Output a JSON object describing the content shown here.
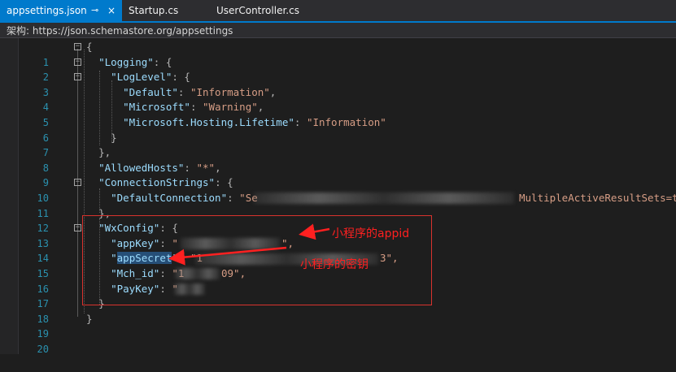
{
  "tabs": [
    {
      "label": "appsettings.json",
      "pin": "⊸",
      "close": "×"
    },
    {
      "label": "Startup.cs"
    },
    {
      "label": "UserController.cs"
    }
  ],
  "schema": {
    "text": "架构: https://json.schemastore.org/appsettings"
  },
  "editor": {
    "line_numbers": [
      "1",
      "2",
      "3",
      "4",
      "5",
      "6",
      "7",
      "8",
      "9",
      "10",
      "11",
      "12",
      "13",
      "14",
      "15",
      "16",
      "17",
      "18",
      "19",
      "20"
    ],
    "l1": "{",
    "l2_key": "\"Logging\"",
    "l2_rest": ": {",
    "l3_key": "\"LogLevel\"",
    "l3_rest": ": {",
    "l4_key": "\"Default\"",
    "l4_sep": ": ",
    "l4_val": "\"Information\"",
    "l4_end": ",",
    "l5_key": "\"Microsoft\"",
    "l5_sep": ": ",
    "l5_val": "\"Warning\"",
    "l5_end": ",",
    "l6_key": "\"Microsoft.Hosting.Lifetime\"",
    "l6_sep": ": ",
    "l6_val": "\"Information\"",
    "l7": "}",
    "l8": "},",
    "l9_key": "\"AllowedHosts\"",
    "l9_sep": ": ",
    "l9_val": "\"*\"",
    "l9_end": ",",
    "l10_key": "\"ConnectionStrings\"",
    "l10_rest": ": {",
    "l11_key": "\"DefaultConnection\"",
    "l11_sep": ": ",
    "l11_val": "\"Se",
    "l11_tail": "MultipleActiveResultSets=t",
    "l12": "},",
    "l13_key": "\"WxConfig\"",
    "l13_rest": ": {",
    "l14_key": "\"appKey\"",
    "l14_sep": ": ",
    "l14_val": "\"",
    "l14_end": "\",",
    "l15_q1": "\"",
    "l15_key": "appSecret",
    "l15_q2": "\"",
    "l15_sep": ": ",
    "l15_val": "\"1",
    "l15_tail": "3\",",
    "l16_key": "\"Mch_id\"",
    "l16_sep": ": ",
    "l16_val": "\"1",
    "l16_tail": "09\",",
    "l17_key": "\"PayKey\"",
    "l17_sep": ": ",
    "l17_val": "\"",
    "l18": "}",
    "l19": "}"
  },
  "annotations": {
    "appid_note": "小程序的appid",
    "secret_note": "小程序的密钥",
    "color": "#ff2020"
  },
  "colors": {
    "accent": "#007acc",
    "key": "#9cdcfe",
    "string": "#d69d85",
    "line_number": "#2b91af",
    "selection": "#264f78"
  }
}
